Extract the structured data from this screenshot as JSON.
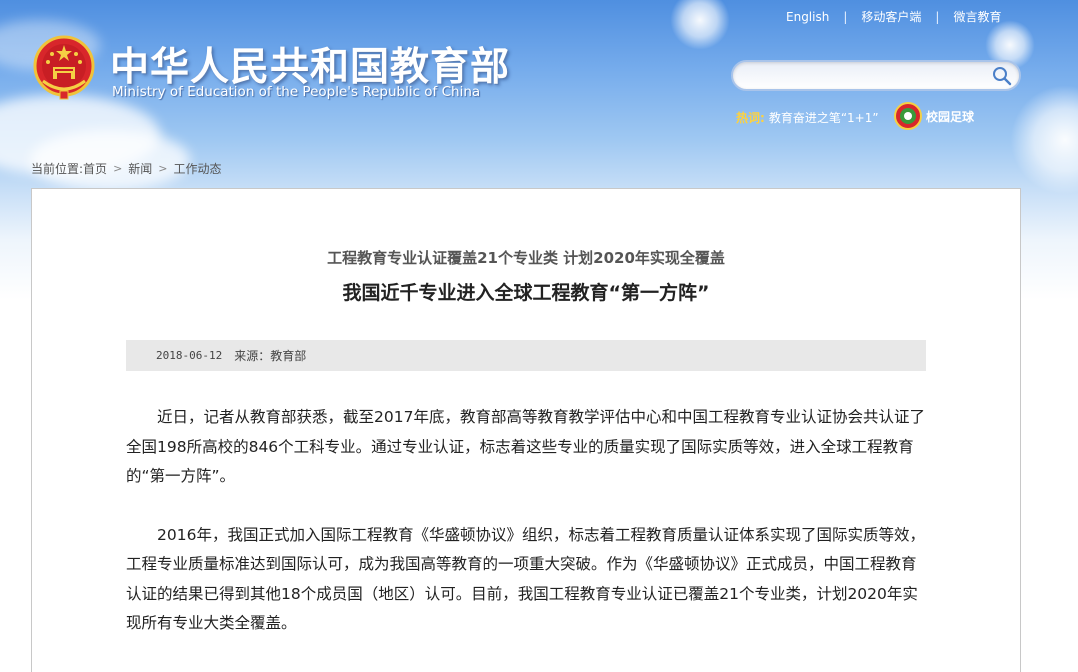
{
  "header": {
    "top_links": [
      "English",
      "移动客户端",
      "微言教育"
    ],
    "title_cn": "中华人民共和国教育部",
    "title_en": "Ministry of Education of the People's Republic of China",
    "search": {
      "value": "",
      "placeholder": ""
    },
    "hot": {
      "label": "热词:",
      "item": "教育奋进之笔“1+1”"
    },
    "football": "校园足球"
  },
  "breadcrumb": {
    "prefix": "当前位置:",
    "items": [
      "首页",
      "新闻",
      "工作动态"
    ]
  },
  "article": {
    "subtitle": "工程教育专业认证覆盖21个专业类 计划2020年实现全覆盖",
    "headline": "我国近千专业进入全球工程教育“第一方阵”",
    "date": "2018-06-12",
    "source": "来源：教育部",
    "paragraphs": [
      "近日，记者从教育部获悉，截至2017年底，教育部高等教育教学评估中心和中国工程教育专业认证协会共认证了全国198所高校的846个工科专业。通过专业认证，标志着这些专业的质量实现了国际实质等效，进入全球工程教育的“第一方阵”。",
      "2016年，我国正式加入国际工程教育《华盛顿协议》组织，标志着工程教育质量认证体系实现了国际实质等效，工程专业质量标准达到国际认可，成为我国高等教育的一项重大突破。作为《华盛顿协议》正式成员，中国工程教育认证的结果已得到其他18个成员国（地区）认可。目前，我国工程教育专业认证已覆盖21个专业类，计划2020年实现所有专业大类全覆盖。"
    ]
  },
  "colors": {
    "sky_top": "#4f8fe0",
    "hot_label": "#ffd23c",
    "meta_bar": "#e8e8e8"
  }
}
